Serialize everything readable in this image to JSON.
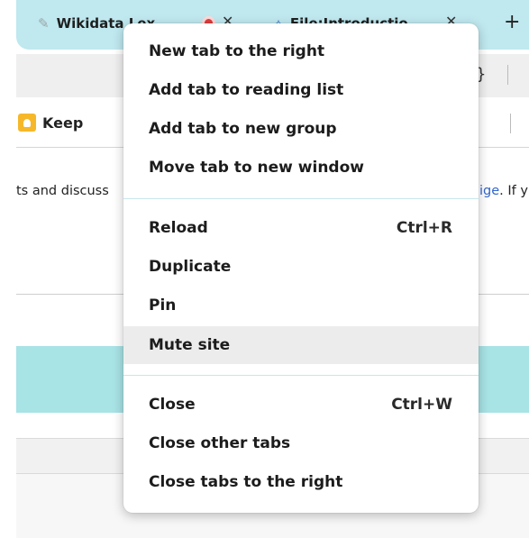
{
  "tabs": [
    {
      "label": "Wikidata Lex",
      "icon": "pencil-icon"
    },
    {
      "label": "File:Introductio",
      "icon": "commons-icon"
    }
  ],
  "toolbar": {
    "brace": "}"
  },
  "bookmarks": {
    "keep_label": "Keep"
  },
  "page": {
    "text_left": "ts and discuss",
    "text_right_link": "ige",
    "text_right_rest": ". If y"
  },
  "context_menu": {
    "groups": [
      [
        {
          "label": "New tab to the right",
          "accel": ""
        },
        {
          "label": "Add tab to reading list",
          "accel": ""
        },
        {
          "label": "Add tab to new group",
          "accel": ""
        },
        {
          "label": "Move tab to new window",
          "accel": ""
        }
      ],
      [
        {
          "label": "Reload",
          "accel": "Ctrl+R"
        },
        {
          "label": "Duplicate",
          "accel": ""
        },
        {
          "label": "Pin",
          "accel": ""
        },
        {
          "label": "Mute site",
          "accel": "",
          "hovered": true
        }
      ],
      [
        {
          "label": "Close",
          "accel": "Ctrl+W"
        },
        {
          "label": "Close other tabs",
          "accel": ""
        },
        {
          "label": "Close tabs to the right",
          "accel": ""
        }
      ]
    ]
  },
  "colors": {
    "tabstrip": "#bfe8ef",
    "menu_separator": "#c8e7ec",
    "hover": "#ececec",
    "teal_band": "#a8e3e6",
    "keep_icon": "#f6b82a",
    "link": "#3366cc"
  }
}
